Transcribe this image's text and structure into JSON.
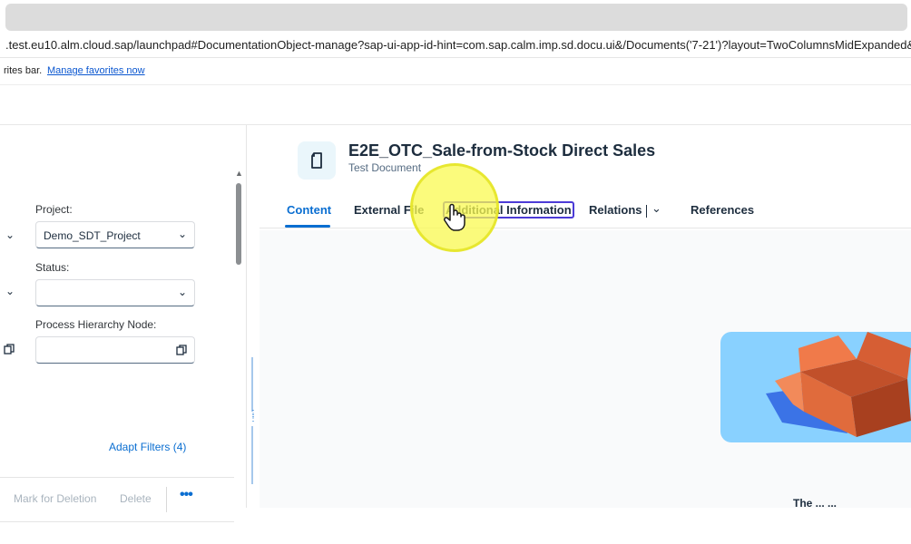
{
  "browser": {
    "url": ".test.eu10.alm.cloud.sap/launchpad#DocumentationObject-manage?sap-ui-app-id-hint=com.sap.calm.imp.sd.docu.ui&/Documents('7-21')?layout=TwoColumnsMidExpanded&sap-iapp-s",
    "favorites_text": "rites bar.",
    "favorites_link": "Manage favorites now"
  },
  "filters": {
    "project_label": "Project:",
    "project_value": "Demo_SDT_Project",
    "status_label": "Status:",
    "status_value": "",
    "process_label": "Process Hierarchy Node:",
    "process_value": "",
    "adapt_filters": "Adapt Filters (4)"
  },
  "toolbar": {
    "mark_for_deletion": "Mark for Deletion",
    "delete": "Delete",
    "more": "•••"
  },
  "document": {
    "title": "E2E_OTC_Sale-from-Stock Direct Sales",
    "subtitle": "Test Document"
  },
  "tabs": [
    {
      "label": "Content"
    },
    {
      "label": "External File"
    },
    {
      "label": "Additional Information"
    },
    {
      "label": "Relations"
    },
    {
      "label": "References"
    }
  ],
  "empty_state": {
    "caption": "The ... ..."
  },
  "colors": {
    "accent": "#0a6ed1",
    "focus_ring": "#4b3bd6",
    "illustration_bg": "#89d1ff",
    "box": "#e06b3c"
  }
}
